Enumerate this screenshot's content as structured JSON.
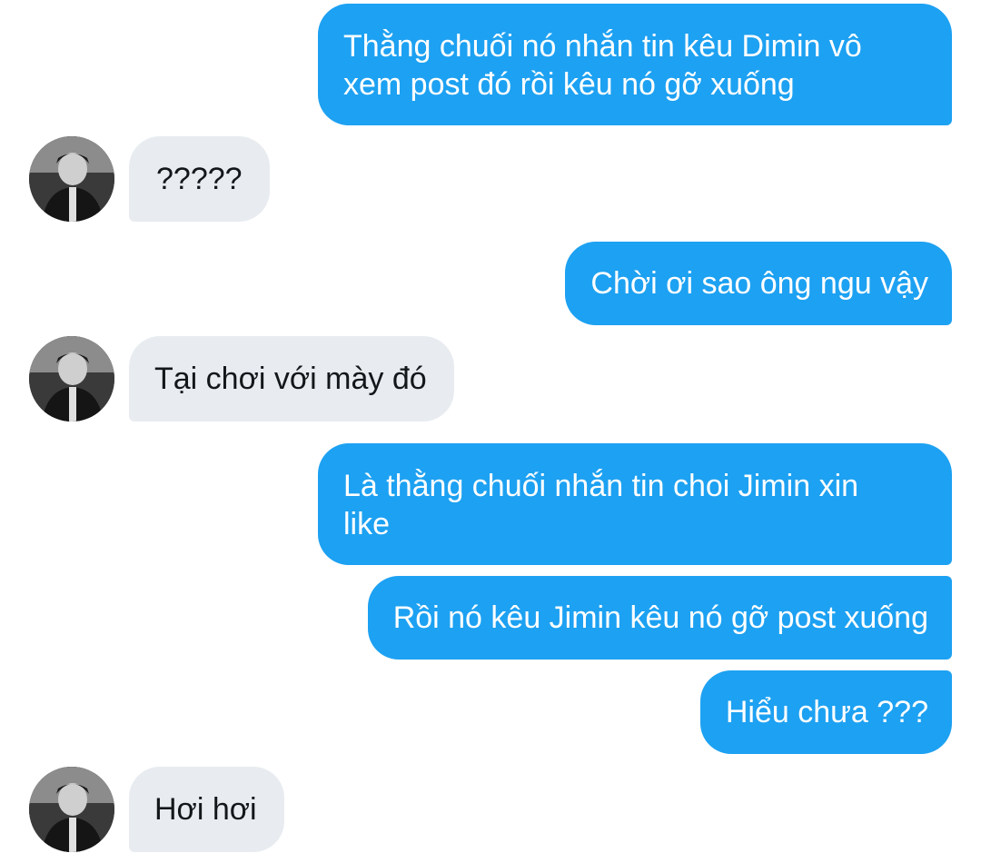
{
  "conversation": {
    "messages": [
      {
        "sender": "me",
        "text": "Thằng chuối nó nhắn tin kêu Dimin vô\nxem post đó rồi kêu nó gỡ xuống"
      },
      {
        "sender": "them",
        "text": "?????"
      },
      {
        "sender": "me",
        "text": "Chời ơi sao ông ngu vậy"
      },
      {
        "sender": "them",
        "text": "Tại chơi với mày đó"
      },
      {
        "sender": "me",
        "text": "Là thằng chuối nhắn tin choi Jimin xin\nlike"
      },
      {
        "sender": "me",
        "text": "Rồi nó kêu Jimin kêu nó gỡ post xuống"
      },
      {
        "sender": "me",
        "text": "Hiểu chưa ???"
      },
      {
        "sender": "them",
        "text": "Hơi hơi"
      }
    ]
  },
  "colors": {
    "sent_bubble": "#1da1f2",
    "sent_text": "#ffffff",
    "received_bubble": "#e8ecf0",
    "received_text": "#14171a",
    "background": "#ffffff"
  },
  "icons": {
    "avatar": "contact-avatar-icon"
  }
}
